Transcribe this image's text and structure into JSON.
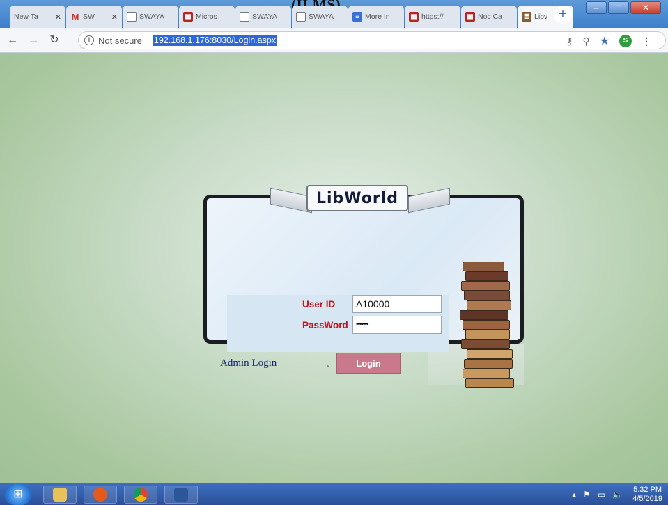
{
  "header_caption": "(ILMS)",
  "browser": {
    "tabs": [
      {
        "label": "New Ta",
        "icon": "page-icon"
      },
      {
        "label": "SW",
        "icon": "gmail-icon"
      },
      {
        "label": "SWAYA",
        "icon": "page-icon"
      },
      {
        "label": "Micros",
        "icon": "app-icon"
      },
      {
        "label": "SWAYA",
        "icon": "page-icon"
      },
      {
        "label": "SWAYA",
        "icon": "page-icon"
      },
      {
        "label": "More In",
        "icon": "docs-icon"
      },
      {
        "label": "https://",
        "icon": "app-icon"
      },
      {
        "label": "Noc Ca",
        "icon": "app-icon"
      },
      {
        "label": "Libv",
        "icon": "libworld-icon"
      }
    ],
    "security_label": "Not secure",
    "url": "192.168.1.176:8030/Login.aspx",
    "profile_initial": "S"
  },
  "login": {
    "brand": "LibWorld",
    "user_id_label": "User ID",
    "user_id_value": "A10000",
    "password_label": "PassWord",
    "password_value": "•••••••",
    "admin_link": "Admin Login",
    "login_button": "Login"
  },
  "taskbar": {
    "time": "5:32 PM",
    "date": "4/5/2019"
  },
  "colors": {
    "label_red": "#c0141c",
    "login_button": "#c9798b",
    "page_bg": "#a9c79f"
  }
}
